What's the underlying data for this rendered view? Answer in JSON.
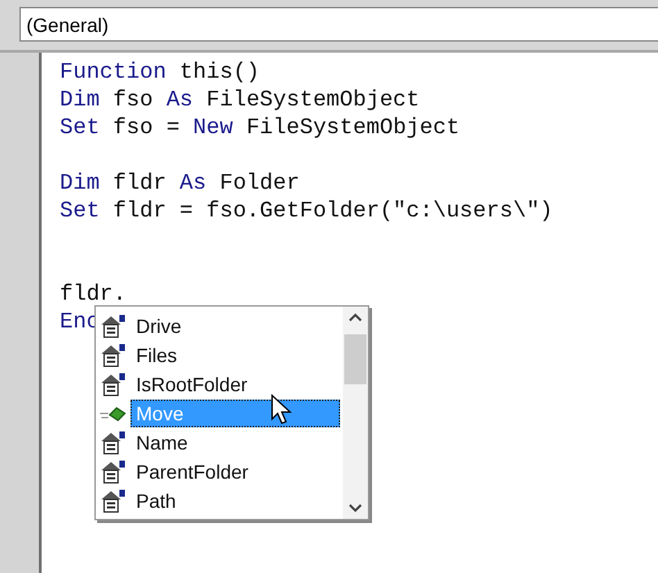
{
  "object_dropdown": {
    "value": "(General)"
  },
  "code_lines": [
    {
      "kind": "code",
      "tokens": [
        {
          "text": "Function",
          "keyword": true
        },
        {
          "text": " this()",
          "keyword": false
        }
      ]
    },
    {
      "kind": "code",
      "tokens": [
        {
          "text": "Dim",
          "keyword": true
        },
        {
          "text": " fso ",
          "keyword": false
        },
        {
          "text": "As",
          "keyword": true
        },
        {
          "text": " FileSystemObject",
          "keyword": false
        }
      ]
    },
    {
      "kind": "code",
      "tokens": [
        {
          "text": "Set",
          "keyword": true
        },
        {
          "text": " fso = ",
          "keyword": false
        },
        {
          "text": "New",
          "keyword": true
        },
        {
          "text": " FileSystemObject",
          "keyword": false
        }
      ]
    },
    {
      "kind": "blank"
    },
    {
      "kind": "code",
      "tokens": [
        {
          "text": "Dim",
          "keyword": true
        },
        {
          "text": " fldr ",
          "keyword": false
        },
        {
          "text": "As",
          "keyword": true
        },
        {
          "text": " Folder",
          "keyword": false
        }
      ]
    },
    {
      "kind": "code",
      "tokens": [
        {
          "text": "Set",
          "keyword": true
        },
        {
          "text": " fldr = fso.GetFolder(\"c:\\users\\\")",
          "keyword": false
        }
      ]
    },
    {
      "kind": "blank"
    },
    {
      "kind": "blank"
    },
    {
      "kind": "code",
      "tokens": [
        {
          "text": "fldr.",
          "keyword": false
        }
      ]
    },
    {
      "kind": "code",
      "tokens": [
        {
          "text": "Enc",
          "keyword": true
        }
      ]
    }
  ],
  "completion_list": [
    {
      "label": "Drive",
      "kind": "property",
      "selected": false
    },
    {
      "label": "Files",
      "kind": "property",
      "selected": false
    },
    {
      "label": "IsRootFolder",
      "kind": "property",
      "selected": false
    },
    {
      "label": "Move",
      "kind": "method",
      "selected": true
    },
    {
      "label": "Name",
      "kind": "property",
      "selected": false
    },
    {
      "label": "ParentFolder",
      "kind": "property",
      "selected": false
    },
    {
      "label": "Path",
      "kind": "property",
      "selected": false
    }
  ]
}
